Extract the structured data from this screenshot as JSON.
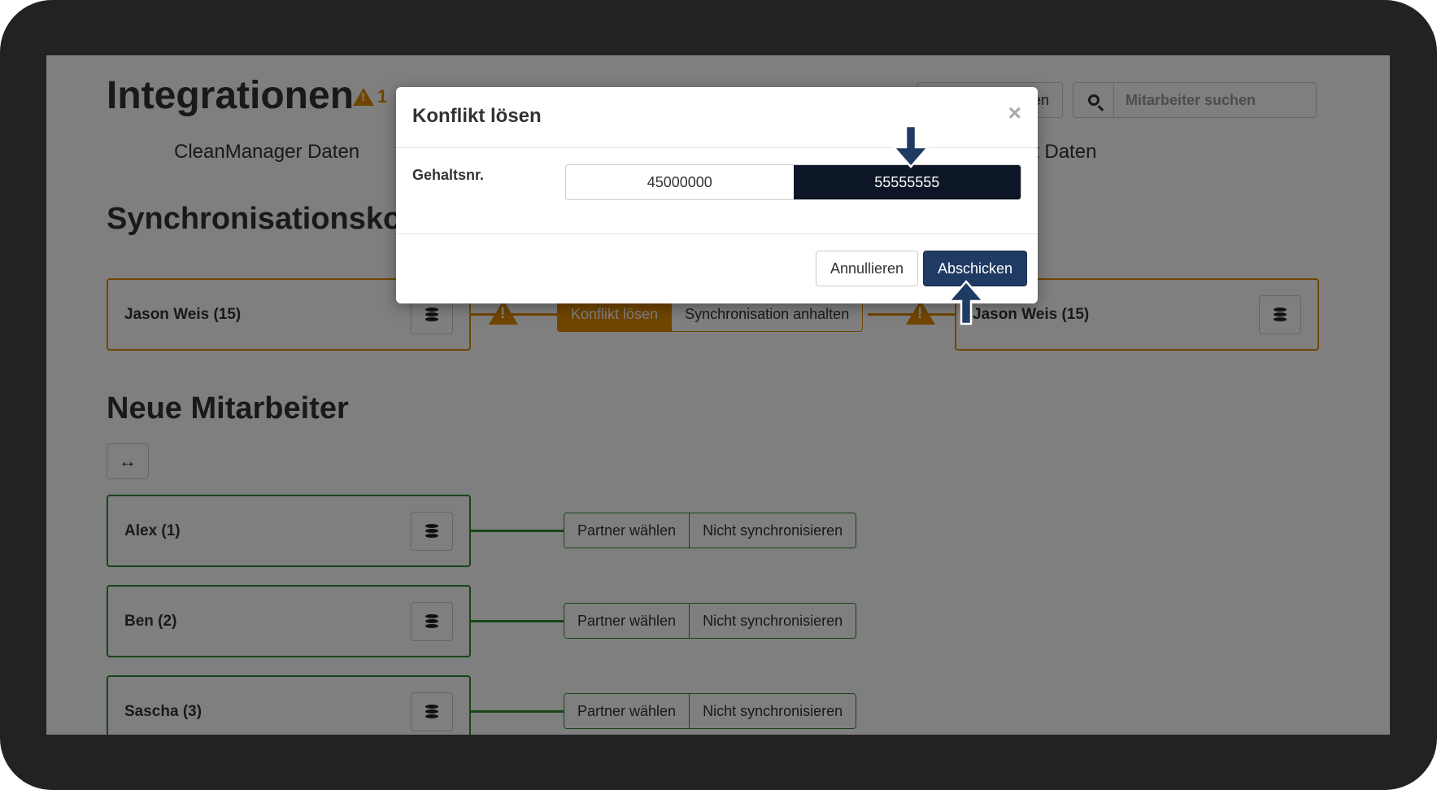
{
  "page": {
    "title": "Integrationen",
    "warning_count": "1",
    "top_button_label": "en",
    "search_placeholder": "Mitarbeiter suchen"
  },
  "columns": {
    "left": "CleanManager Daten",
    "right": "Dateiimport Daten"
  },
  "sync_conflicts": {
    "title": "Synchronisationsko",
    "row": {
      "left_label": "Jason Weis (15)",
      "right_label": "Jason Weis (15)",
      "resolve_label": "Konflikt lösen",
      "pause_label": "Synchronisation anhalten"
    }
  },
  "new_employees": {
    "title": "Neue Mitarbeiter",
    "toggle_icon": "↔",
    "rows": [
      {
        "label": "Alex (1)",
        "partner_label": "Partner wählen",
        "nosync_label": "Nicht synchronisieren"
      },
      {
        "label": "Ben (2)",
        "partner_label": "Partner wählen",
        "nosync_label": "Nicht synchronisieren"
      },
      {
        "label": "Sascha (3)",
        "partner_label": "Partner wählen",
        "nosync_label": "Nicht synchronisieren"
      }
    ]
  },
  "modal": {
    "title": "Konflikt lösen",
    "close_glyph": "×",
    "field_label": "Gehaltsnr.",
    "option_left": "45000000",
    "option_right": "55555555",
    "selected": "right",
    "cancel_label": "Annullieren",
    "submit_label": "Abschicken"
  },
  "colors": {
    "accent_orange": "#e08a00",
    "accent_green": "#2e8b2e",
    "primary_button": "#1f3a63",
    "selected_option": "#0d1626",
    "frame": "#232223"
  },
  "icons": [
    "warning-icon",
    "search-icon",
    "database-icon",
    "close-icon",
    "arrows-horizontal-icon",
    "arrow-down-icon",
    "arrow-up-icon"
  ]
}
